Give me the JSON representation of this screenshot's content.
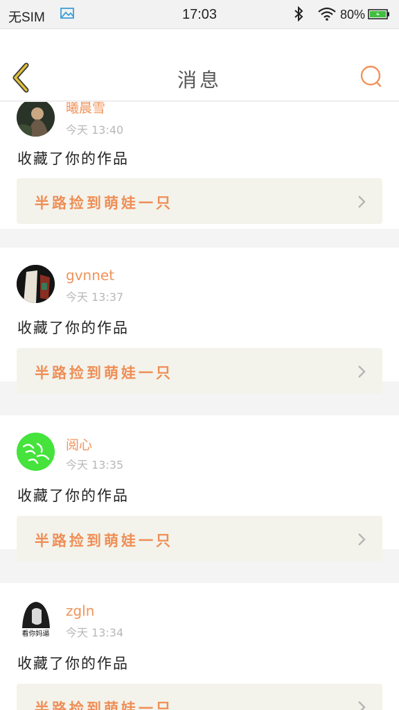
{
  "status_bar": {
    "carrier": "无SIM",
    "time": "17:03",
    "battery": "80%"
  },
  "nav": {
    "title": "消息"
  },
  "colors": {
    "accent": "#f0935a",
    "back_arrow": "#c9a21e",
    "card_tint": "#f3f3ec"
  },
  "messages": [
    {
      "username": "曦晨雪",
      "time": "今天 13:40",
      "action": "收藏了你的作品",
      "work_title": "半路捡到萌娃一只"
    },
    {
      "username": "gvnnet",
      "time": "今天 13:37",
      "action": "收藏了你的作品",
      "work_title": "半路捡到萌娃一只"
    },
    {
      "username": "阅心",
      "time": "今天 13:35",
      "action": "收藏了你的作品",
      "work_title": "半路捡到萌娃一只"
    },
    {
      "username": "zgln",
      "time": "今天 13:34",
      "action": "收藏了你的作品",
      "work_title": "半路捡到萌娃一只",
      "avatar_caption": "看你妈逼"
    }
  ]
}
